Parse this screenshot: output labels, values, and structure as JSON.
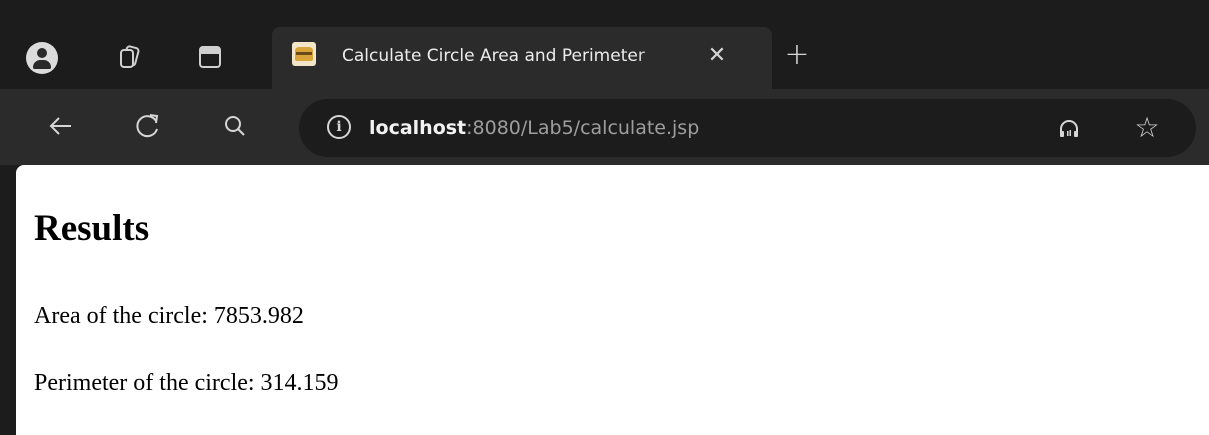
{
  "browser": {
    "tab": {
      "title": "Calculate Circle Area and Perimeter",
      "close_glyph": "✕"
    },
    "new_tab_glyph": "+",
    "toolbar": {
      "back_glyph": "←",
      "reload_glyph": "↻",
      "search_glyph": "⌕"
    },
    "address": {
      "host": "localhost",
      "rest": ":8080/Lab5/calculate.jsp"
    },
    "favorite_glyph": "☆"
  },
  "page": {
    "heading": "Results",
    "area_line": "Area of the circle: 7853.982",
    "perimeter_line": "Perimeter of the circle: 314.159"
  }
}
